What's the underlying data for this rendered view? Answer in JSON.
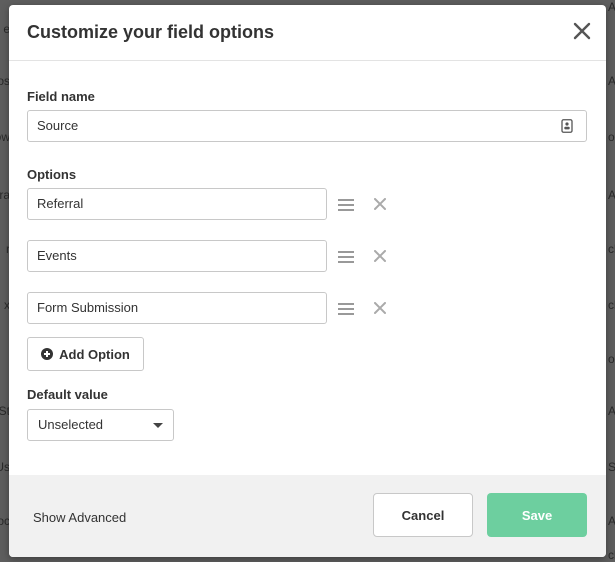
{
  "background": {
    "left_fragments": [
      "e",
      "os",
      "ow",
      "ra",
      "r",
      "x",
      "St",
      "Us",
      "oc"
    ],
    "right_fragments": [
      "A",
      "A",
      "oc",
      "A",
      "ck",
      "ck",
      "oc",
      "A",
      "St",
      "A",
      "ck"
    ]
  },
  "modal": {
    "title": "Customize your field options",
    "field_name_label": "Field name",
    "field_name_value": "Source",
    "options_label": "Options",
    "options": [
      "Referral",
      "Events",
      "Form Submission"
    ],
    "add_option_label": "Add Option",
    "default_value_label": "Default value",
    "default_value_selected": "Unselected"
  },
  "footer": {
    "show_advanced_label": "Show Advanced",
    "cancel_label": "Cancel",
    "save_label": "Save"
  },
  "colors": {
    "save_button": "#6dcf9f",
    "footer_bg": "#f1f1f1",
    "overlay": "#5e5e5e"
  },
  "icons": {
    "close": "close-icon",
    "field_type": "id-card-icon",
    "drag": "drag-handle-icon",
    "remove": "remove-icon",
    "add": "plus-circle-icon",
    "dropdown": "chevron-down-icon"
  }
}
